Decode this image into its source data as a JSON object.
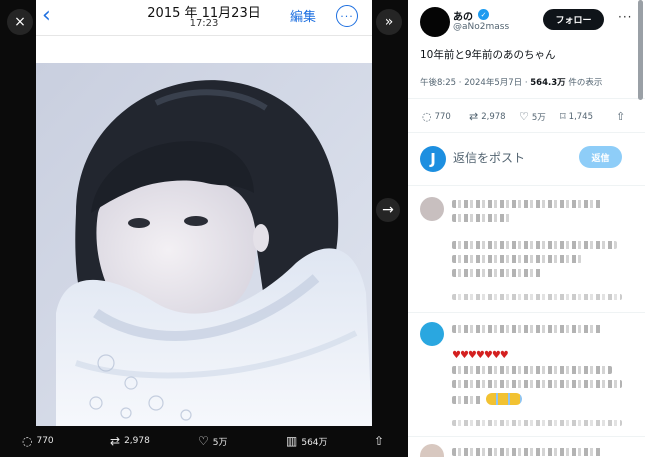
{
  "viewer": {
    "close_icon": "×",
    "collapse_icon": "»",
    "next_icon": "→",
    "phone": {
      "back_icon": "‹",
      "date": "2015 年 11月23日",
      "time": "17:23",
      "edit_label": "編集",
      "more_icon": "···"
    },
    "actions": [
      {
        "icon": "speech-bubble-icon",
        "glyph": "◌",
        "label": "770"
      },
      {
        "icon": "retweet-icon",
        "glyph": "⇄",
        "label": "2,978"
      },
      {
        "icon": "heart-icon",
        "glyph": "♡",
        "label": "5万"
      },
      {
        "icon": "views-icon",
        "glyph": "▥",
        "label": "564万"
      },
      {
        "icon": "share-icon",
        "glyph": "⇧",
        "label": ""
      }
    ]
  },
  "post": {
    "author_name": "あの",
    "verified_glyph": "✓",
    "author_handle": "@aNo2mass",
    "follow_label": "フォロー",
    "more_icon": "···",
    "text": "10年前と9年前のあのちゃん",
    "meta_time": "午後8:25 · 2024年5月7日 · ",
    "meta_views": "564.3万",
    "meta_views_suffix": " 件の表示",
    "actions": [
      {
        "icon": "reply-icon",
        "glyph": "◌",
        "label": "770"
      },
      {
        "icon": "retweet-icon",
        "glyph": "⇄",
        "label": "2,978"
      },
      {
        "icon": "like-icon",
        "glyph": "♡",
        "label": "5万"
      },
      {
        "icon": "bookmark-icon",
        "glyph": "⌑",
        "label": "1,745"
      },
      {
        "icon": "share-icon",
        "glyph": "⇧",
        "label": ""
      }
    ]
  },
  "reply_box": {
    "avatar_letter": "J",
    "placeholder": "返信をポスト",
    "button_label": "返信"
  },
  "replies": {
    "hearts": "♥♥♥♥♥♥♥"
  },
  "colors": {
    "link_blue": "#1d6fe0",
    "verified_blue": "#1d9bf0",
    "reply_btn_disabled": "#8ecdf8"
  }
}
